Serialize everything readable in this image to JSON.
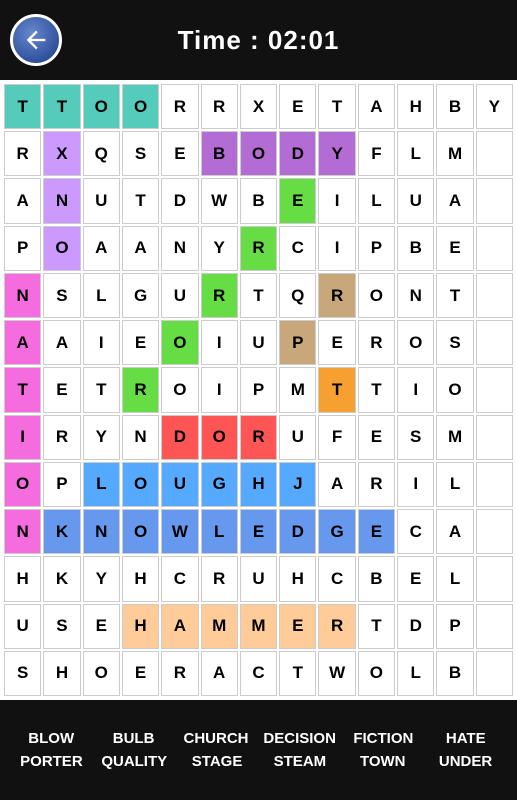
{
  "header": {
    "timer_label": "Time : 02:01",
    "back_label": "Back"
  },
  "grid": {
    "rows": 13,
    "cols": 13,
    "cells": [
      [
        "T",
        "T",
        "O",
        "O",
        "R",
        "R",
        "X",
        "E",
        "T",
        "A",
        "H",
        "B",
        "Y"
      ],
      [
        "R",
        "X",
        "Q",
        "S",
        "E",
        "B",
        "O",
        "D",
        "Y",
        "F",
        "L",
        "M",
        ""
      ],
      [
        "A",
        "N",
        "U",
        "T",
        "D",
        "W",
        "B",
        "E",
        "I",
        "L",
        "U",
        "A",
        ""
      ],
      [
        "P",
        "O",
        "A",
        "A",
        "N",
        "Y",
        "R",
        "C",
        "I",
        "P",
        "B",
        "E",
        ""
      ],
      [
        "N",
        "S",
        "L",
        "G",
        "U",
        "R",
        "T",
        "Q",
        "R",
        "O",
        "N",
        "T",
        ""
      ],
      [
        "A",
        "A",
        "I",
        "E",
        "O",
        "I",
        "U",
        "P",
        "E",
        "R",
        "O",
        "S",
        ""
      ],
      [
        "T",
        "E",
        "T",
        "R",
        "O",
        "I",
        "P",
        "M",
        "T",
        "T",
        "I",
        "O",
        ""
      ],
      [
        "I",
        "R",
        "Y",
        "N",
        "D",
        "O",
        "R",
        "U",
        "F",
        "E",
        "S",
        "M",
        ""
      ],
      [
        "O",
        "P",
        "L",
        "O",
        "U",
        "G",
        "H",
        "J",
        "A",
        "R",
        "I",
        "L",
        ""
      ],
      [
        "N",
        "K",
        "N",
        "O",
        "W",
        "L",
        "E",
        "D",
        "G",
        "E",
        "C",
        "A",
        ""
      ],
      [
        "H",
        "K",
        "Y",
        "H",
        "C",
        "R",
        "U",
        "H",
        "C",
        "B",
        "E",
        "L",
        ""
      ],
      [
        "U",
        "S",
        "E",
        "H",
        "A",
        "M",
        "M",
        "E",
        "R",
        "T",
        "D",
        "P",
        ""
      ],
      [
        "S",
        "H",
        "O",
        "E",
        "R",
        "A",
        "C",
        "T",
        "W",
        "O",
        "L",
        "B",
        ""
      ]
    ],
    "highlights": {
      "nation": [
        [
          0,
          1
        ],
        [
          1,
          1
        ],
        [
          2,
          1
        ],
        [
          3,
          1
        ],
        [
          4,
          0
        ],
        [
          5,
          0
        ],
        [
          6,
          0
        ],
        [
          7,
          0
        ],
        [
          8,
          0
        ]
      ],
      "body": [
        [
          1,
          5
        ],
        [
          1,
          6
        ],
        [
          1,
          7
        ],
        [
          1,
          8
        ]
      ],
      "knowledge": [
        [
          9,
          1
        ],
        [
          9,
          2
        ],
        [
          9,
          3
        ],
        [
          9,
          4
        ],
        [
          9,
          5
        ],
        [
          9,
          6
        ],
        [
          9,
          7
        ],
        [
          9,
          8
        ],
        [
          9,
          9
        ]
      ],
      "hammer": [
        [
          11,
          3
        ],
        [
          11,
          4
        ],
        [
          11,
          5
        ],
        [
          11,
          6
        ],
        [
          11,
          7
        ],
        [
          11,
          8
        ]
      ],
      "door": [
        [
          7,
          4
        ],
        [
          7,
          5
        ],
        [
          7,
          6
        ]
      ],
      "plough": [
        [
          8,
          2
        ],
        [
          8,
          3
        ],
        [
          8,
          4
        ],
        [
          8,
          5
        ],
        [
          8,
          6
        ],
        [
          8,
          7
        ]
      ],
      "diagonal_green": [
        [
          3,
          6
        ],
        [
          4,
          5
        ],
        [
          5,
          4
        ],
        [
          6,
          3
        ],
        [
          7,
          2
        ]
      ],
      "tan_r": [
        [
          4,
          8
        ],
        [
          5,
          7
        ],
        [
          6,
          7
        ]
      ]
    }
  },
  "words": [
    {
      "text": "BLOW",
      "found": false
    },
    {
      "text": "BULB",
      "found": false
    },
    {
      "text": "CHURCH",
      "found": false
    },
    {
      "text": "DECISION",
      "found": false
    },
    {
      "text": "FICTION",
      "found": false
    },
    {
      "text": "HATE",
      "found": false
    },
    {
      "text": "PORTER",
      "found": false
    },
    {
      "text": "QUALITY",
      "found": false
    },
    {
      "text": "STAGE",
      "found": false
    },
    {
      "text": "STEAM",
      "found": false
    },
    {
      "text": "TOWN",
      "found": false
    },
    {
      "text": "UNDER",
      "found": false
    }
  ]
}
